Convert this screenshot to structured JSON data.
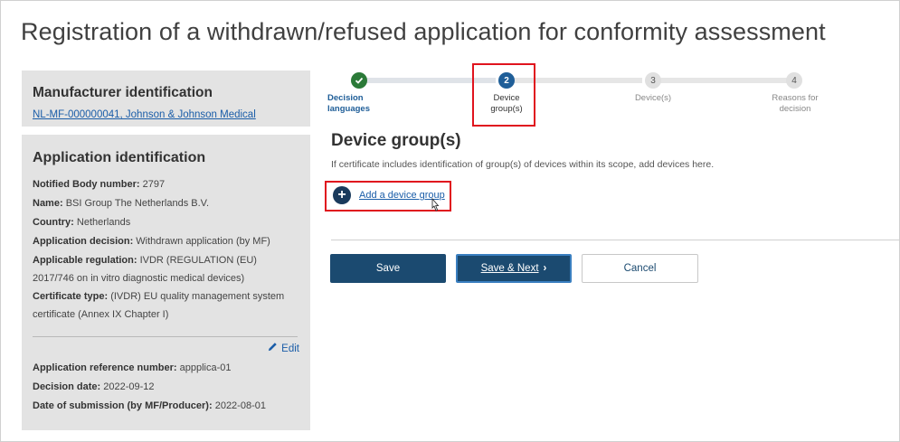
{
  "page": {
    "title": "Registration of a withdrawn/refused application for conformity assessment"
  },
  "manufacturer": {
    "heading": "Manufacturer identification",
    "link": "NL-MF-000000041, Johnson & Johnson Medical"
  },
  "application": {
    "heading": "Application identification",
    "fields": [
      {
        "label": "Notified Body number:",
        "value": "2797"
      },
      {
        "label": "Name:",
        "value": "BSI Group The Netherlands B.V."
      },
      {
        "label": "Country:",
        "value": "Netherlands"
      },
      {
        "label": "Application decision:",
        "value": "Withdrawn application (by MF)"
      },
      {
        "label": "Applicable regulation:",
        "value": "IVDR (REGULATION (EU) 2017/746 on in vitro diagnostic medical devices)"
      },
      {
        "label": "Certificate type:",
        "value": "(IVDR) EU quality management system certificate (Annex IX Chapter I)"
      }
    ],
    "edit_label": "Edit",
    "lower_fields": [
      {
        "label": "Application reference number:",
        "value": "appplica-01"
      },
      {
        "label": "Decision date:",
        "value": "2022-09-12"
      },
      {
        "label": "Date of submission (by MF/Producer):",
        "value": "2022-08-01"
      }
    ]
  },
  "stepper": {
    "steps": [
      {
        "number": "✔",
        "label_line1": "Decision",
        "label_line2": "languages",
        "state": "done"
      },
      {
        "number": "2",
        "label_line1": "Device",
        "label_line2": "group(s)",
        "state": "active"
      },
      {
        "number": "3",
        "label_line1": "Device(s)",
        "label_line2": "",
        "state": "todo"
      },
      {
        "number": "4",
        "label_line1": "Reasons for",
        "label_line2": "decision",
        "state": "todo"
      }
    ]
  },
  "section": {
    "title": "Device group(s)",
    "description": "If certificate includes identification of group(s) of devices within its scope, add devices here.",
    "add_link": "Add a device group"
  },
  "buttons": {
    "save": "Save",
    "save_next": "Save & Next",
    "save_next_chevron": "›",
    "cancel": "Cancel"
  },
  "colors": {
    "primary_button": "#1b4a70",
    "link": "#1a5da8",
    "step_done": "#2b7a38",
    "step_active": "#1f5e98",
    "highlight": "#e0141e",
    "panel_bg": "#e3e3e3"
  },
  "icons": {
    "step_done": "check-icon",
    "add": "plus-circle-icon",
    "edit": "pencil-icon",
    "cursor": "pointer-cursor-icon",
    "next": "chevron-right-icon"
  }
}
